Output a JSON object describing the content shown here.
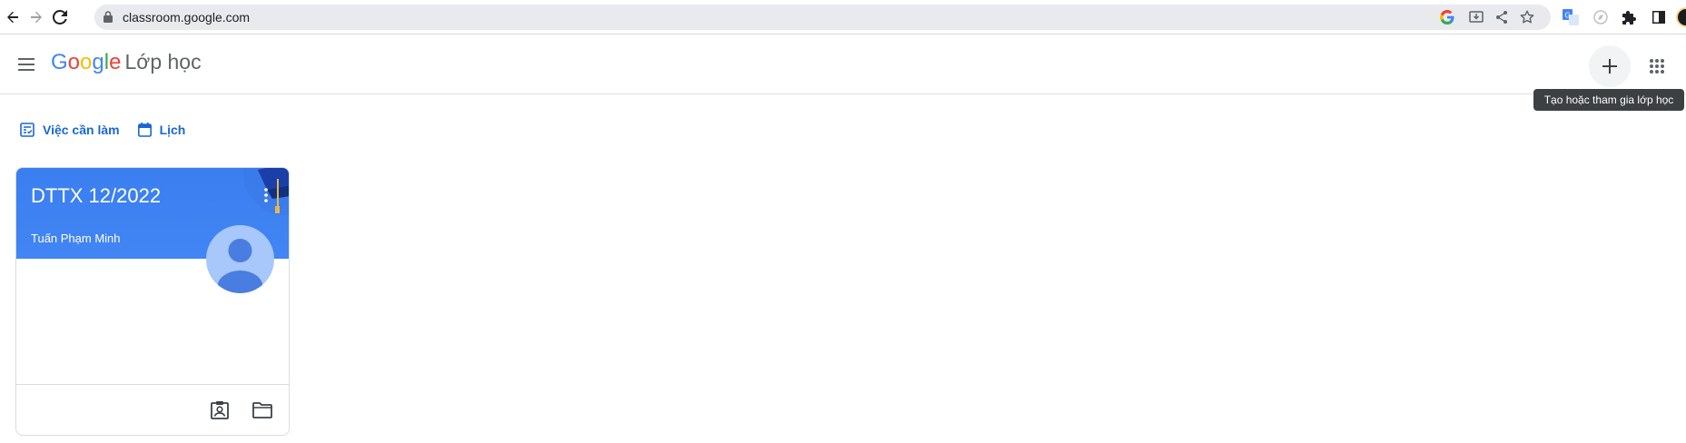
{
  "browser": {
    "url": "classroom.google.com",
    "icons": [
      "back-arrow-icon",
      "forward-arrow-icon",
      "reload-icon",
      "lock-icon",
      "google-icon",
      "install-app-icon",
      "share-icon",
      "bookmark-star-icon",
      "translate-icon",
      "extension-icon",
      "puzzle-icon",
      "side-panel-icon"
    ]
  },
  "header": {
    "logo_letters": [
      "G",
      "o",
      "o",
      "g",
      "l",
      "e"
    ],
    "logo_colors": [
      "#4285f4",
      "#ea4335",
      "#fbbc05",
      "#4285f4",
      "#34a853",
      "#ea4335"
    ],
    "product_name": "Lớp học",
    "tooltip": "Tạo hoặc tham gia lớp học"
  },
  "links": {
    "todo": "Việc cần làm",
    "calendar": "Lịch"
  },
  "classes": [
    {
      "title": "DTTX 12/2022",
      "teacher": "Tuấn Phạm Minh",
      "banner_color": "#4285f4"
    }
  ],
  "colors": {
    "accent": "#1967d2",
    "banner": "#4285f4",
    "tooltip_bg": "#3c4043"
  }
}
